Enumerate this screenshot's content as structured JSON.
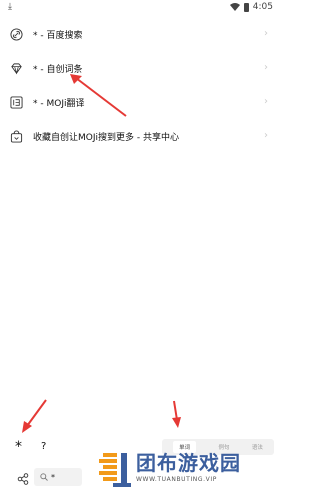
{
  "status_bar": {
    "left_icon": "download-icon",
    "left_glyph": "⤓",
    "time": "4:05"
  },
  "menu": [
    {
      "icon": "link-icon",
      "label": "* - 百度搜索"
    },
    {
      "icon": "diamond-icon",
      "label": "* - 自创词条"
    },
    {
      "icon": "translate-icon",
      "label": "* - MOJi翻译"
    },
    {
      "icon": "bag-icon",
      "label": "收藏自创让MOJi搜到更多 - 共享中心"
    }
  ],
  "bottom": {
    "star": "*",
    "question": "?",
    "tabs": [
      "单词",
      "例句",
      "语法"
    ],
    "active_tab": 0,
    "search_value": "*"
  },
  "watermark": {
    "cn": "团布游戏园",
    "en": "WWW.TUANBUTING.VIP"
  },
  "colors": {
    "arrow": "#e53935",
    "logo": "#3c5f9e"
  }
}
